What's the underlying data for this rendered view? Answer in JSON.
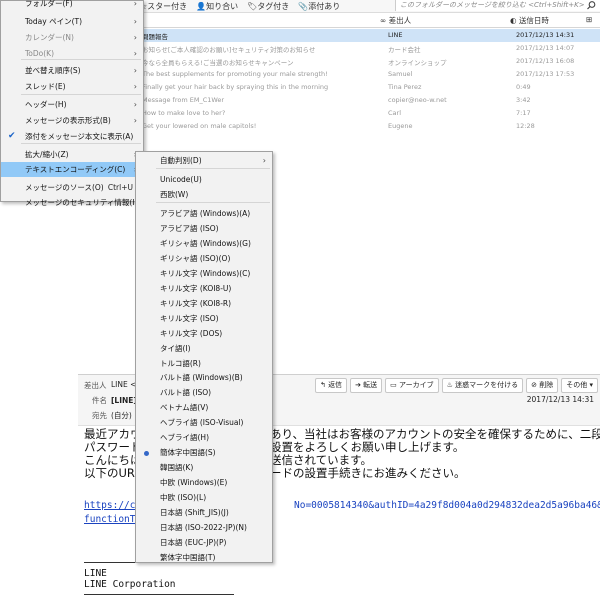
{
  "toolbar": {
    "filters": [
      {
        "label": "スター付き",
        "icon": "star-icon"
      },
      {
        "label": "知り合い",
        "icon": "contact-icon"
      },
      {
        "label": "タグ付き",
        "icon": "tag-icon"
      },
      {
        "label": "添付あり",
        "icon": "paperclip-icon"
      }
    ],
    "quick_filter_placeholder": "このフォルダーのメッセージを絞り込む <Ctrl+Shift+K>"
  },
  "thread_columns": {
    "sender": "差出人",
    "date": "送信日時"
  },
  "threads": [
    {
      "subject": "問題報告",
      "sender": "LINE",
      "date": "2017/12/13 14:31",
      "selected": true
    },
    {
      "subject": "お知らせ[ご本人確認のお願い]セキュリティ対策のお知らせ",
      "sender": "カード会社",
      "date": "2017/12/13 14:07",
      "selected": false
    },
    {
      "subject": "今なら全員もらえる!ご当選のお知らせキャンペーン",
      "sender": "オンラインショップ",
      "date": "2017/12/13 16:08",
      "selected": false
    },
    {
      "subject": "The best supplements for promoting your male strength!",
      "sender": "Samuel",
      "date": "2017/12/13 17:53",
      "selected": false
    },
    {
      "subject": "Finally get your hair back by spraying this in the morning",
      "sender": "Tina Perez",
      "date": "0:49",
      "selected": false
    },
    {
      "subject": "Message from EM_C1Wer",
      "sender": "copier@neo-w.net",
      "date": "3:42",
      "selected": false
    },
    {
      "subject": "How to make love to her?",
      "sender": "Carl",
      "date": "7:17",
      "selected": false
    },
    {
      "subject": "Get your lowered on male capitols!",
      "sender": "Eugene",
      "date": "12:28",
      "selected": false
    }
  ],
  "view_menu": {
    "items": [
      {
        "label": "フォルダー(F)",
        "arrow": true,
        "dim": false
      },
      {
        "label": "Today ペイン(T)",
        "arrow": true,
        "dim": false
      },
      {
        "label": "カレンダー(N)",
        "arrow": true,
        "dim": true
      },
      {
        "label": "ToDo(K)",
        "arrow": true,
        "dim": true
      },
      {
        "label": "並べ替え順序(S)",
        "arrow": true,
        "dim": false
      },
      {
        "label": "スレッド(E)",
        "arrow": true,
        "dim": false
      },
      {
        "label": "ヘッダー(H)",
        "arrow": true,
        "dim": false
      },
      {
        "label": "メッセージの表示形式(B)",
        "arrow": true,
        "dim": false
      },
      {
        "label": "添付をメッセージ本文に表示(A)",
        "arrow": false,
        "dim": false,
        "checked": true
      },
      {
        "label": "拡大/縮小(Z)",
        "arrow": true,
        "dim": false
      },
      {
        "label": "テキストエンコーディング(C)",
        "arrow": true,
        "dim": false,
        "highlighted": true
      },
      {
        "label": "メッセージのソース(O)",
        "shortcut": "Ctrl+U",
        "arrow": false,
        "dim": false
      },
      {
        "label": "メッセージのセキュリティ情報(I)",
        "arrow": false,
        "dim": false
      }
    ]
  },
  "encoding_menu": {
    "items": [
      {
        "label": "自動判別(D)",
        "arrow": true
      },
      {
        "label": "Unicode(U)"
      },
      {
        "label": "西欧(W)"
      },
      {
        "label": "アラビア語 (Windows)(A)"
      },
      {
        "label": "アラビア語 (ISO)"
      },
      {
        "label": "ギリシャ語 (Windows)(G)"
      },
      {
        "label": "ギリシャ語 (ISO)(O)"
      },
      {
        "label": "キリル文字 (Windows)(C)"
      },
      {
        "label": "キリル文字 (KOI8-U)"
      },
      {
        "label": "キリル文字 (KOI8-R)"
      },
      {
        "label": "キリル文字 (ISO)"
      },
      {
        "label": "キリル文字 (DOS)"
      },
      {
        "label": "タイ語(I)"
      },
      {
        "label": "トルコ語(R)"
      },
      {
        "label": "バルト語 (Windows)(B)"
      },
      {
        "label": "バルト語 (ISO)"
      },
      {
        "label": "ベトナム語(V)"
      },
      {
        "label": "ヘブライ語 (ISO-Visual)"
      },
      {
        "label": "ヘブライ語(H)"
      },
      {
        "label": "簡体字中国語(S)",
        "selected": true
      },
      {
        "label": "韓国語(K)"
      },
      {
        "label": "中欧 (Windows)(E)"
      },
      {
        "label": "中欧 (ISO)(L)"
      },
      {
        "label": "日本語 (Shift_JIS)(J)"
      },
      {
        "label": "日本語 (ISO-2022-JP)(N)"
      },
      {
        "label": "日本語 (EUC-JP)(P)"
      },
      {
        "label": "繁体字中国語(T)"
      }
    ]
  },
  "message": {
    "from_label": "差出人",
    "from_value": "LINE <d",
    "subject_label": "件名",
    "subject_value": "[LINE] 問",
    "to_label": "宛先",
    "to_value": "(自分) <",
    "date": "2017/12/13 14:31",
    "actions": [
      {
        "label": "返信",
        "icon": "reply-icon"
      },
      {
        "label": "転送",
        "icon": "forward-icon"
      },
      {
        "label": "アーカイブ",
        "icon": "archive-icon"
      },
      {
        "label": "迷惑マークを付ける",
        "icon": "junk-icon"
      },
      {
        "label": "削除",
        "icon": "delete-icon"
      },
      {
        "label": "その他",
        "icon": "chevron-down-icon"
      }
    ],
    "body_lines": [
      "最近アカウ",
      "パスワード",
      "こんにちは",
      "以下のURLを"
    ],
    "body_right_lines": [
      "あり、当社はお客様のアカウントの安全を確保するために、二段階",
      "設置をよろしくお願い申し上げます。",
      "送信されています。",
      "ードの設置手続きにお進みください。"
    ],
    "link_start": "https://co",
    "link_end": "No=0005814340&authID=4a29f8d004a0d294832dea2d5a96ba46&",
    "link_line2": "functionTy",
    "signature": [
      "LINE",
      "LINE Corporation"
    ]
  }
}
